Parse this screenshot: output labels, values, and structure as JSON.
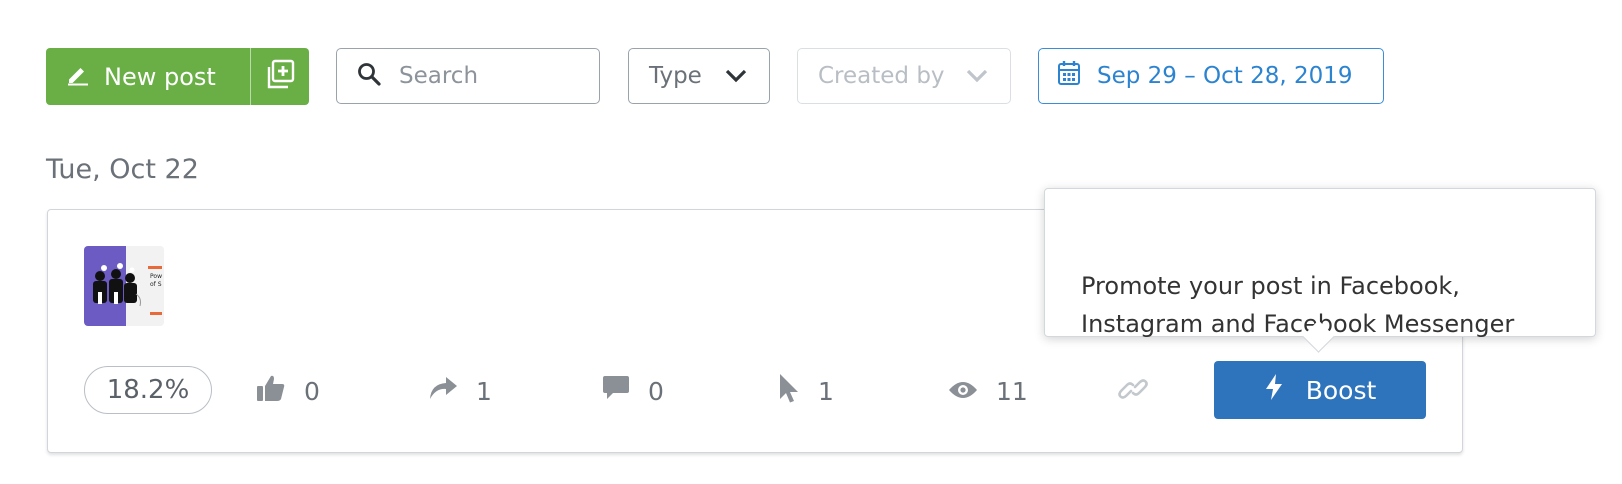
{
  "toolbar": {
    "new_post_label": "New post",
    "search_placeholder": "Search",
    "type_label": "Type",
    "created_by_label": "Created by",
    "date_range": "Sep 29 – Oct 28, 2019"
  },
  "date_heading": "Tue, Oct 22",
  "post": {
    "engagement_rate": "18.2%",
    "stats": {
      "likes": "0",
      "shares": "1",
      "comments": "0",
      "clicks": "1",
      "views": "11"
    },
    "boost_label": "Boost"
  },
  "tooltip": {
    "text": "Promote your post in Facebook,\nInstagram and Facebook Messenger"
  },
  "colors": {
    "green": "#6aaf46",
    "blue_button": "#2e74bd",
    "blue_accent": "#2c84d1"
  },
  "icons": [
    "pencil-icon",
    "duplicate-icon",
    "search-icon",
    "chevron-down-icon",
    "calendar-icon",
    "thumbs-up-icon",
    "share-icon",
    "comment-icon",
    "cursor-icon",
    "eye-icon",
    "link-icon",
    "lightning-icon"
  ]
}
